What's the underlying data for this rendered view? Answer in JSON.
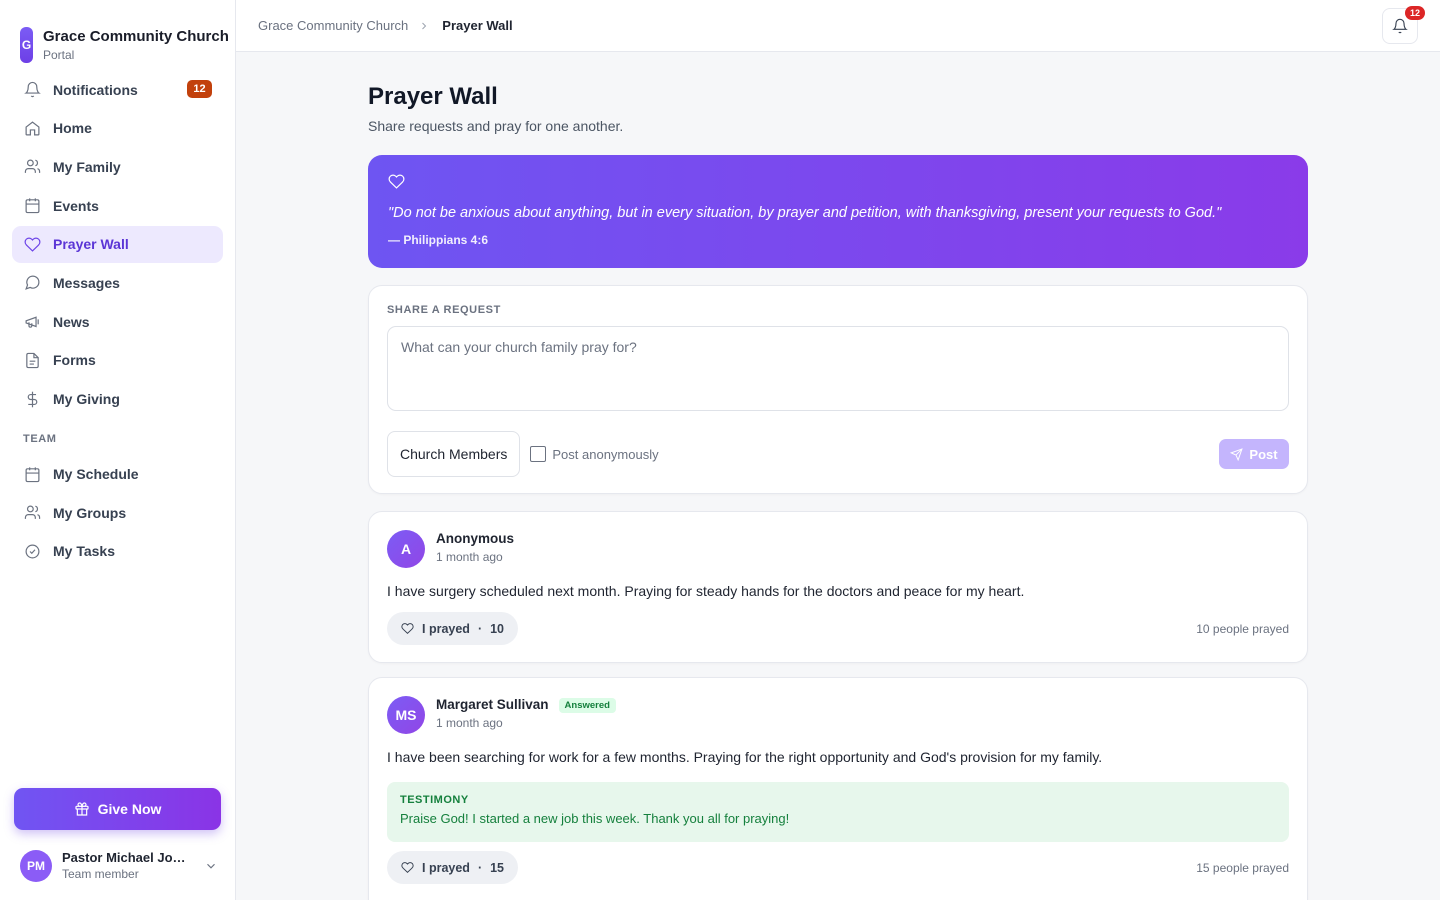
{
  "brand": {
    "logo_letter": "G",
    "name": "Grace Community Church",
    "subtitle": "Portal"
  },
  "sidebar": {
    "items": [
      {
        "label": "Notifications",
        "icon": "bell-icon",
        "badge": "12"
      },
      {
        "label": "Home",
        "icon": "home-icon"
      },
      {
        "label": "My Family",
        "icon": "users-icon"
      },
      {
        "label": "Events",
        "icon": "calendar-icon"
      },
      {
        "label": "Prayer Wall",
        "icon": "heart-icon",
        "active": true
      },
      {
        "label": "Messages",
        "icon": "message-icon"
      },
      {
        "label": "News",
        "icon": "megaphone-icon"
      },
      {
        "label": "Forms",
        "icon": "document-icon"
      },
      {
        "label": "My Giving",
        "icon": "dollar-icon"
      }
    ],
    "team_label": "TEAM",
    "team_items": [
      {
        "label": "My Schedule",
        "icon": "calendar-icon"
      },
      {
        "label": "My Groups",
        "icon": "users-icon"
      },
      {
        "label": "My Tasks",
        "icon": "check-circle-icon"
      }
    ],
    "give_label": "Give Now",
    "user": {
      "initials": "PM",
      "name": "Pastor Michael Johnson",
      "role": "Team member"
    }
  },
  "topbar": {
    "breadcrumb_root": "Grace Community Church",
    "breadcrumb_current": "Prayer Wall",
    "notification_count": "12"
  },
  "page": {
    "title": "Prayer Wall",
    "subtitle": "Share requests and pray for one another."
  },
  "verse": {
    "text": "\"Do not be anxious about anything, but in every situation, by prayer and petition, with thanksgiving, present your requests to God.\"",
    "reference": "— Philippians 4:6"
  },
  "share": {
    "eyebrow": "SHARE A REQUEST",
    "placeholder": "What can your church family pray for?",
    "value": "",
    "audience": "Church Members",
    "anonymous_label": "Post anonymously",
    "anonymous_checked": false,
    "post_label": "Post"
  },
  "prayers": [
    {
      "initials": "A",
      "name": "Anonymous",
      "time": "1 month ago",
      "text": "I have surgery scheduled next month. Praying for steady hands for the doctors and peace for my heart.",
      "pray_label": "I prayed",
      "count": "10",
      "count_text": "10 people prayed"
    },
    {
      "initials": "MS",
      "name": "Margaret Sullivan",
      "badge": "Answered",
      "time": "1 month ago",
      "text": "I have been searching for work for a few months. Praying for the right opportunity and God's provision for my family.",
      "testimony_label": "TESTIMONY",
      "testimony_text": "Praise God! I started a new job this week. Thank you all for praying!",
      "pray_label": "I prayed",
      "count": "15",
      "count_text": "15 people prayed"
    }
  ],
  "colors": {
    "accent": "#6d44e8",
    "badge_orange": "#c2410c",
    "answered_green": "#15803d"
  }
}
